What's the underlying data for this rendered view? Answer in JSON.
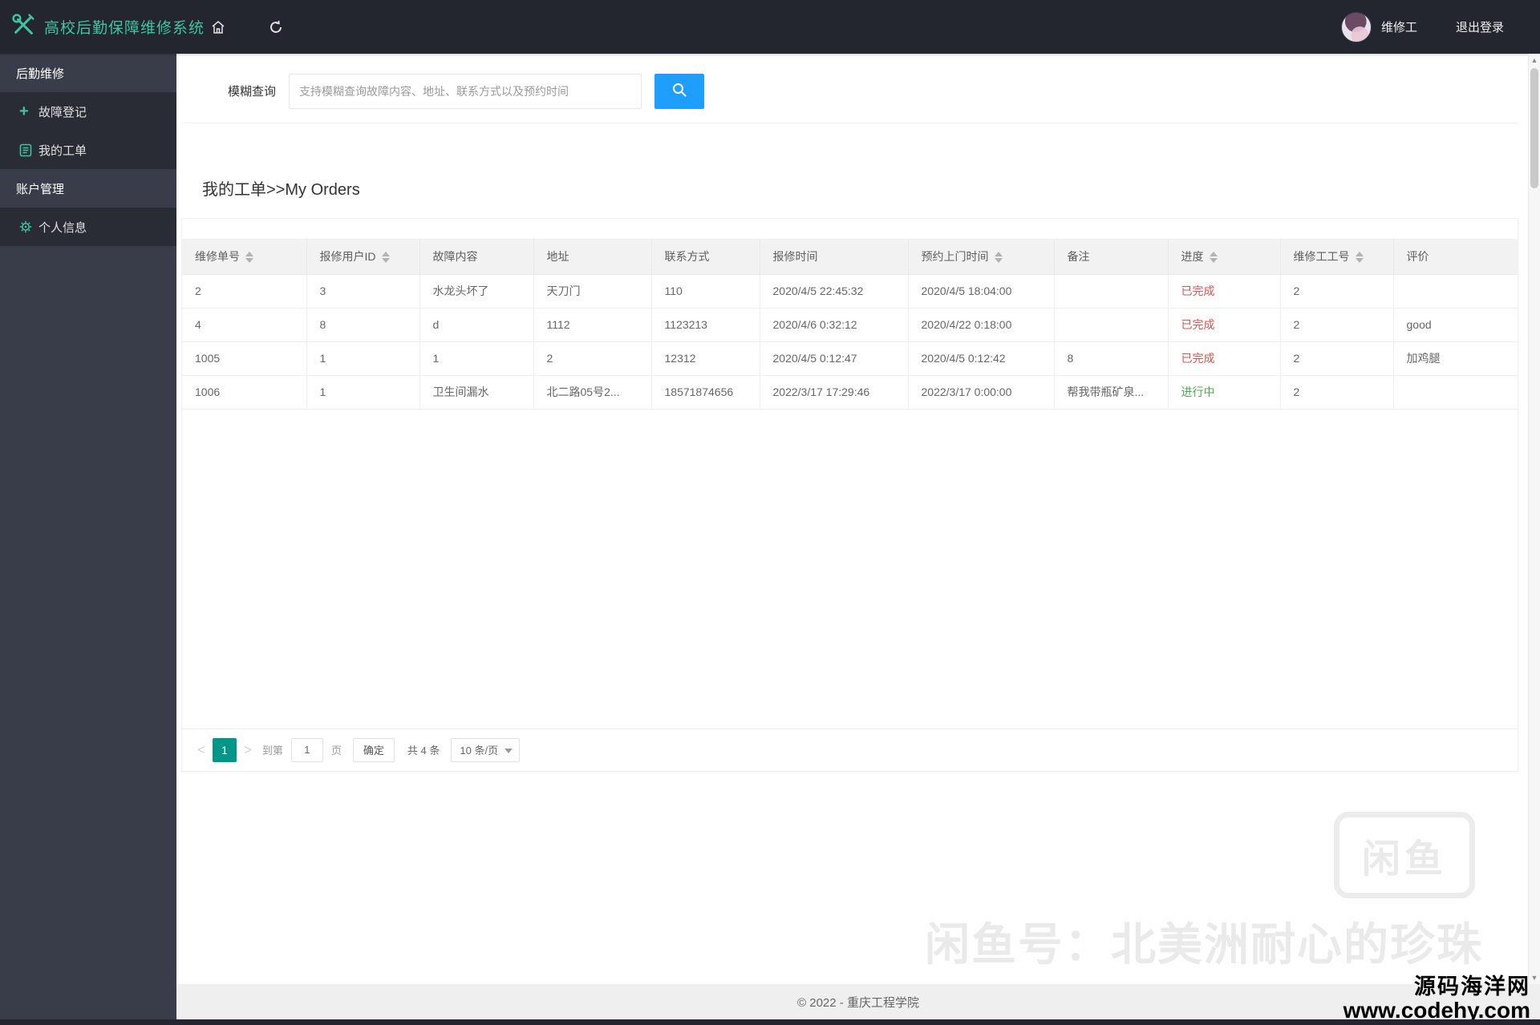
{
  "navbar": {
    "title": "高校后勤保障维修系统",
    "user": "维修工",
    "logout": "退出登录"
  },
  "sidebar": {
    "groups": [
      {
        "label": "后勤维修",
        "items": [
          {
            "label": "故障登记",
            "icon": "plus-icon"
          },
          {
            "label": "我的工单",
            "icon": "document-icon"
          }
        ]
      },
      {
        "label": "账户管理",
        "items": [
          {
            "label": "个人信息",
            "icon": "gear-icon"
          }
        ]
      }
    ]
  },
  "search": {
    "label": "模糊查询",
    "placeholder": "支持模糊查询故障内容、地址、联系方式以及预约时间",
    "value": ""
  },
  "page": {
    "title": "我的工单>>My Orders"
  },
  "table": {
    "columns": [
      {
        "label": "维修单号",
        "sortable": true
      },
      {
        "label": "报修用户ID",
        "sortable": true
      },
      {
        "label": "故障内容",
        "sortable": false
      },
      {
        "label": "地址",
        "sortable": false
      },
      {
        "label": "联系方式",
        "sortable": false
      },
      {
        "label": "报修时间",
        "sortable": false
      },
      {
        "label": "预约上门时间",
        "sortable": true
      },
      {
        "label": "备注",
        "sortable": false
      },
      {
        "label": "进度",
        "sortable": true,
        "key": "progress"
      },
      {
        "label": "维修工工号",
        "sortable": true
      },
      {
        "label": "评价",
        "sortable": false
      }
    ],
    "rows": [
      [
        "2",
        "3",
        "水龙头坏了",
        "天刀门",
        "110",
        "2020/4/5 22:45:32",
        "2020/4/5 18:04:00",
        "",
        "已完成",
        "2",
        ""
      ],
      [
        "4",
        "8",
        "d",
        "1112",
        "1123213",
        "2020/4/6 0:32:12",
        "2020/4/22 0:18:00",
        "",
        "已完成",
        "2",
        "good"
      ],
      [
        "1005",
        "1",
        "1",
        "2",
        "12312",
        "2020/4/5 0:12:47",
        "2020/4/5 0:12:42",
        "8",
        "已完成",
        "2",
        "加鸡腿"
      ],
      [
        "1006",
        "1",
        "卫生间漏水",
        "北二路05号2...",
        "18571874656",
        "2022/3/17 17:29:46",
        "2022/3/17 0:00:00",
        "帮我带瓶矿泉...",
        "进行中",
        "2",
        ""
      ]
    ]
  },
  "pagination": {
    "current": "1",
    "goto_label": "到第",
    "goto_value": "1",
    "page_label": "页",
    "confirm": "确定",
    "total": "共 4 条",
    "page_size": "10 条/页"
  },
  "footer": {
    "copyright": "© 2022 - 重庆工程学院"
  },
  "watermarks": {
    "xianyu_logo": "闲鱼",
    "xianyu_text": "闲鱼号：北美洲耐心的珍珠",
    "site_name": "源码海洋网",
    "site_url": "www.codehy.com"
  },
  "colors": {
    "accent": "#3fc3a3",
    "primary_blue": "#1e9fff",
    "active_page": "#009688",
    "status": {
      "已完成": "#d9534f",
      "进行中": "#4cab50"
    }
  }
}
